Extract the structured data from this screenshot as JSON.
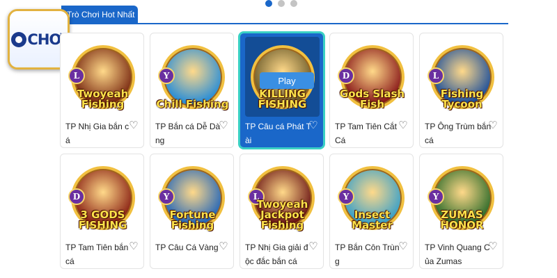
{
  "carousel": {
    "active_index": 0,
    "count": 3
  },
  "brand": {
    "logo_text": "CHƠI"
  },
  "tab": {
    "label": "Trò Chơi Hot Nhất"
  },
  "games": [
    {
      "name": "TP Nhị Gia bắn cá",
      "logo_text": "Twoyeah Fishing",
      "emblem": "L",
      "bg": "#7a2a12"
    },
    {
      "name": "TP Bắn cá Dễ Dàng",
      "logo_text": "Chill Fishing",
      "emblem": "Y",
      "bg": "#2b8ed6"
    },
    {
      "name": "TP Câu cá Phát Tài",
      "logo_text": "KILLING FISHING",
      "emblem": "",
      "bg": "#6a5a2a",
      "play_label": "Play"
    },
    {
      "name": "TP Tam Tiên Cắt Cá",
      "logo_text": "Gods Slash Fish",
      "emblem": "D",
      "bg": "#8a1a1a"
    },
    {
      "name": "TP Ông Trùm bắn cá",
      "logo_text": "Fishing Tycoon",
      "emblem": "L",
      "bg": "#1d4f9a"
    },
    {
      "name": "TP Tam Tiên bắn cá",
      "logo_text": "3 GODS FISHING",
      "emblem": "D",
      "bg": "#8a2214"
    },
    {
      "name": "TP Câu Cá Vàng",
      "logo_text": "Fortune Fishing",
      "emblem": "Y",
      "bg": "#2466b8"
    },
    {
      "name": "TP Nhị Gia giải độc đắc bắn cá",
      "logo_text": "Twoyeah Jackpot Fishing",
      "emblem": "L",
      "bg": "#6a1414"
    },
    {
      "name": "TP Bắn Côn Trùng",
      "logo_text": "Insect Master",
      "emblem": "Y",
      "bg": "#3aa0c8"
    },
    {
      "name": "TP Vinh Quang Của Zumas",
      "logo_text": "ZUMAS HONOR",
      "emblem": "Y",
      "bg": "#2e6b2a"
    }
  ],
  "hovered_index": 2,
  "icons": {
    "favorite": "heart-outline-icon"
  },
  "colors": {
    "accent": "#1a67c9",
    "hover_border": "#38d1c3",
    "play_button": "#3a8fe3"
  }
}
